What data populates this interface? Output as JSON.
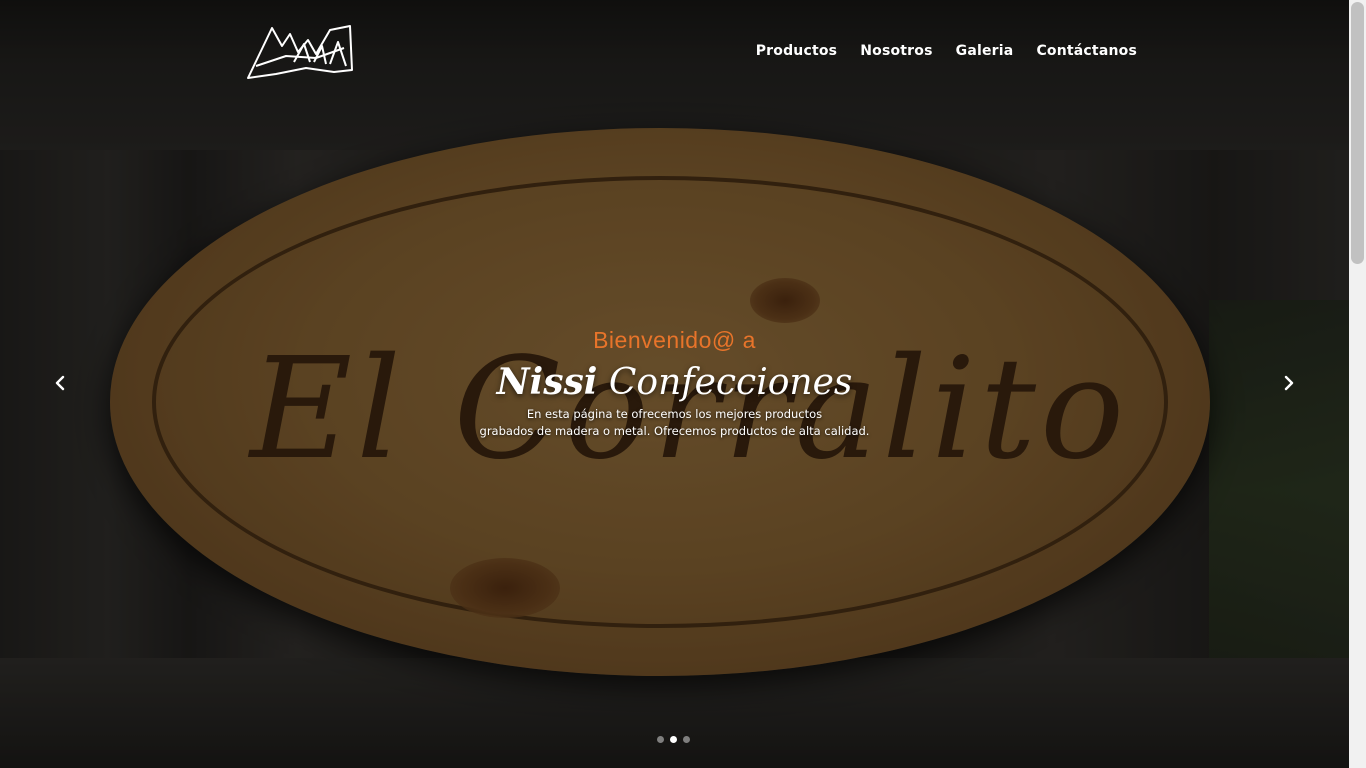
{
  "nav": {
    "items": [
      "Productos",
      "Nosotros",
      "Galeria",
      "Contáctanos"
    ]
  },
  "hero": {
    "pretitle": "Bienvenido@ a",
    "brand_word1": "Nissi",
    "brand_word2": "Confecciones",
    "desc_line1": "En esta página te ofrecemos los mejores productos",
    "desc_line2": "grabados de madera o metal. Ofrecemos productos de alta calidad.",
    "background_sign_text": "El Corralito",
    "active_slide": 2,
    "slide_count": 3
  },
  "icons": {
    "logo": "nissi-logo",
    "prev": "chevron-left-icon",
    "next": "chevron-right-icon"
  },
  "colors": {
    "accent": "#e8742a",
    "nav_text": "#ffffff"
  }
}
